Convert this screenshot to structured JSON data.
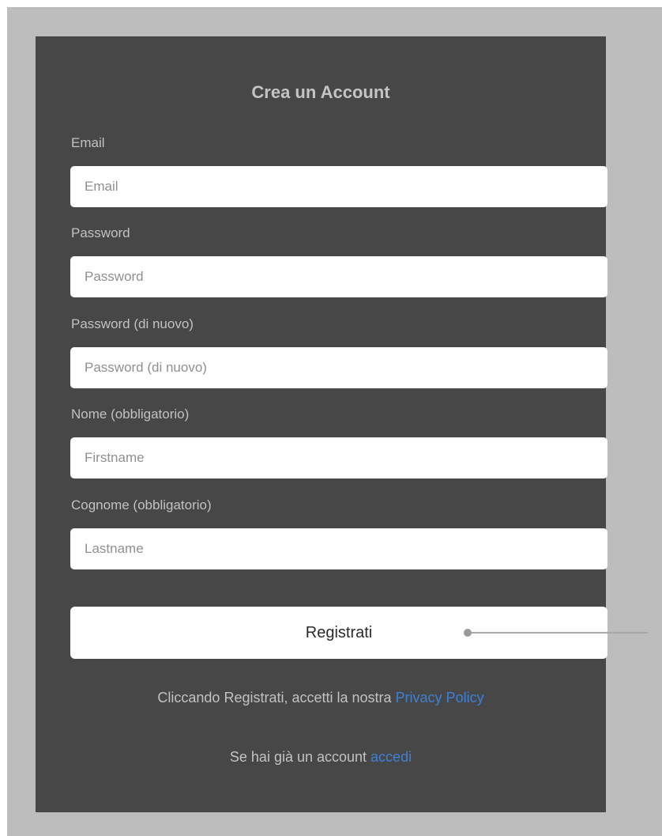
{
  "form": {
    "title": "Crea un Account",
    "fields": [
      {
        "label": "Email",
        "placeholder": "Email"
      },
      {
        "label": "Password",
        "placeholder": "Password"
      },
      {
        "label": "Password (di nuovo)",
        "placeholder": "Password (di nuovo)"
      },
      {
        "label": "Nome (obbligatorio)",
        "placeholder": "Firstname"
      },
      {
        "label": "Cognome (obbligatorio)",
        "placeholder": "Lastname"
      }
    ],
    "submit_label": "Registrati",
    "privacy_prefix": "Cliccando Registrati, accetti la nostra ",
    "privacy_link": "Privacy Policy",
    "login_prefix": "Se hai già un account ",
    "login_link": "accedi"
  },
  "colors": {
    "panel_background": "#474747",
    "frame_background": "#bdbdbd",
    "link": "#3f80d3"
  }
}
